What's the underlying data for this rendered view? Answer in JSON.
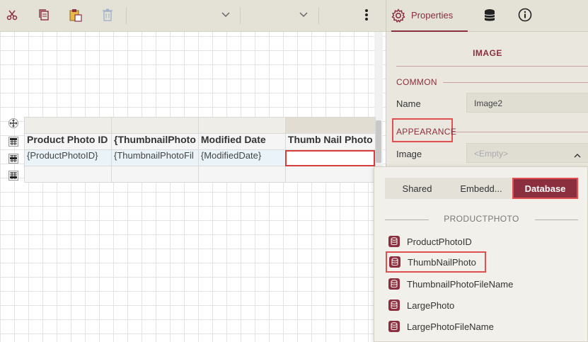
{
  "toolbar": {
    "icons": [
      "cut-icon",
      "copy-icon",
      "paste-icon",
      "delete-icon",
      "chevron-down-icon",
      "chevron-down-icon",
      "more-vertical-icon"
    ]
  },
  "table": {
    "headers": [
      "Product Photo ID",
      "{ThumbnailPhoto",
      "Modified Date",
      "Thumb Nail Photo"
    ],
    "data_row": [
      "{ProductPhotoID}",
      "{ThumbnailPhotoFil",
      "{ModifiedDate}",
      ""
    ]
  },
  "panel": {
    "tabs": {
      "properties": "Properties"
    },
    "title": "IMAGE",
    "sections": {
      "common": "COMMON",
      "appearance": "APPEARANCE"
    },
    "props": {
      "name_label": "Name",
      "name_value": "Image2",
      "image_label": "Image",
      "image_placeholder": "<Empty>"
    }
  },
  "popup": {
    "segments": [
      "Shared",
      "Embedd...",
      "Database"
    ],
    "active_segment": "Database",
    "group_title": "PRODUCTPHOTO",
    "fields": [
      "ProductPhotoID",
      "ThumbNailPhoto",
      "ThumbnailPhotoFileName",
      "LargePhoto",
      "LargePhotoFileName"
    ],
    "selected_field": "ThumbNailPhoto"
  },
  "colors": {
    "accent": "#8b2e3e",
    "highlight": "#e05050",
    "panel_bg": "#eae7de"
  }
}
